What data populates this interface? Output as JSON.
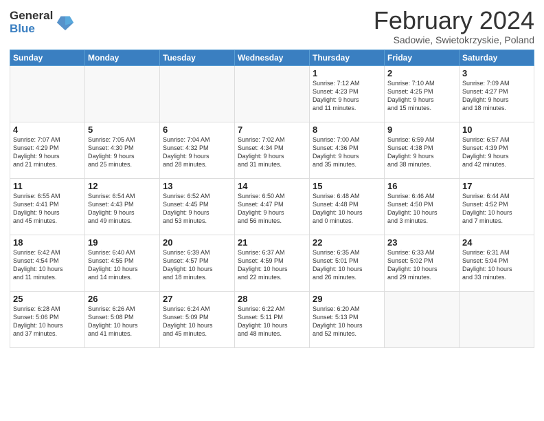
{
  "header": {
    "logo_general": "General",
    "logo_blue": "Blue",
    "title": "February 2024",
    "location": "Sadowie, Swietokrzyskie, Poland"
  },
  "weekdays": [
    "Sunday",
    "Monday",
    "Tuesday",
    "Wednesday",
    "Thursday",
    "Friday",
    "Saturday"
  ],
  "weeks": [
    [
      {
        "day": "",
        "info": ""
      },
      {
        "day": "",
        "info": ""
      },
      {
        "day": "",
        "info": ""
      },
      {
        "day": "",
        "info": ""
      },
      {
        "day": "1",
        "info": "Sunrise: 7:12 AM\nSunset: 4:23 PM\nDaylight: 9 hours\nand 11 minutes."
      },
      {
        "day": "2",
        "info": "Sunrise: 7:10 AM\nSunset: 4:25 PM\nDaylight: 9 hours\nand 15 minutes."
      },
      {
        "day": "3",
        "info": "Sunrise: 7:09 AM\nSunset: 4:27 PM\nDaylight: 9 hours\nand 18 minutes."
      }
    ],
    [
      {
        "day": "4",
        "info": "Sunrise: 7:07 AM\nSunset: 4:29 PM\nDaylight: 9 hours\nand 21 minutes."
      },
      {
        "day": "5",
        "info": "Sunrise: 7:05 AM\nSunset: 4:30 PM\nDaylight: 9 hours\nand 25 minutes."
      },
      {
        "day": "6",
        "info": "Sunrise: 7:04 AM\nSunset: 4:32 PM\nDaylight: 9 hours\nand 28 minutes."
      },
      {
        "day": "7",
        "info": "Sunrise: 7:02 AM\nSunset: 4:34 PM\nDaylight: 9 hours\nand 31 minutes."
      },
      {
        "day": "8",
        "info": "Sunrise: 7:00 AM\nSunset: 4:36 PM\nDaylight: 9 hours\nand 35 minutes."
      },
      {
        "day": "9",
        "info": "Sunrise: 6:59 AM\nSunset: 4:38 PM\nDaylight: 9 hours\nand 38 minutes."
      },
      {
        "day": "10",
        "info": "Sunrise: 6:57 AM\nSunset: 4:39 PM\nDaylight: 9 hours\nand 42 minutes."
      }
    ],
    [
      {
        "day": "11",
        "info": "Sunrise: 6:55 AM\nSunset: 4:41 PM\nDaylight: 9 hours\nand 45 minutes."
      },
      {
        "day": "12",
        "info": "Sunrise: 6:54 AM\nSunset: 4:43 PM\nDaylight: 9 hours\nand 49 minutes."
      },
      {
        "day": "13",
        "info": "Sunrise: 6:52 AM\nSunset: 4:45 PM\nDaylight: 9 hours\nand 53 minutes."
      },
      {
        "day": "14",
        "info": "Sunrise: 6:50 AM\nSunset: 4:47 PM\nDaylight: 9 hours\nand 56 minutes."
      },
      {
        "day": "15",
        "info": "Sunrise: 6:48 AM\nSunset: 4:48 PM\nDaylight: 10 hours\nand 0 minutes."
      },
      {
        "day": "16",
        "info": "Sunrise: 6:46 AM\nSunset: 4:50 PM\nDaylight: 10 hours\nand 3 minutes."
      },
      {
        "day": "17",
        "info": "Sunrise: 6:44 AM\nSunset: 4:52 PM\nDaylight: 10 hours\nand 7 minutes."
      }
    ],
    [
      {
        "day": "18",
        "info": "Sunrise: 6:42 AM\nSunset: 4:54 PM\nDaylight: 10 hours\nand 11 minutes."
      },
      {
        "day": "19",
        "info": "Sunrise: 6:40 AM\nSunset: 4:55 PM\nDaylight: 10 hours\nand 14 minutes."
      },
      {
        "day": "20",
        "info": "Sunrise: 6:39 AM\nSunset: 4:57 PM\nDaylight: 10 hours\nand 18 minutes."
      },
      {
        "day": "21",
        "info": "Sunrise: 6:37 AM\nSunset: 4:59 PM\nDaylight: 10 hours\nand 22 minutes."
      },
      {
        "day": "22",
        "info": "Sunrise: 6:35 AM\nSunset: 5:01 PM\nDaylight: 10 hours\nand 26 minutes."
      },
      {
        "day": "23",
        "info": "Sunrise: 6:33 AM\nSunset: 5:02 PM\nDaylight: 10 hours\nand 29 minutes."
      },
      {
        "day": "24",
        "info": "Sunrise: 6:31 AM\nSunset: 5:04 PM\nDaylight: 10 hours\nand 33 minutes."
      }
    ],
    [
      {
        "day": "25",
        "info": "Sunrise: 6:28 AM\nSunset: 5:06 PM\nDaylight: 10 hours\nand 37 minutes."
      },
      {
        "day": "26",
        "info": "Sunrise: 6:26 AM\nSunset: 5:08 PM\nDaylight: 10 hours\nand 41 minutes."
      },
      {
        "day": "27",
        "info": "Sunrise: 6:24 AM\nSunset: 5:09 PM\nDaylight: 10 hours\nand 45 minutes."
      },
      {
        "day": "28",
        "info": "Sunrise: 6:22 AM\nSunset: 5:11 PM\nDaylight: 10 hours\nand 48 minutes."
      },
      {
        "day": "29",
        "info": "Sunrise: 6:20 AM\nSunset: 5:13 PM\nDaylight: 10 hours\nand 52 minutes."
      },
      {
        "day": "",
        "info": ""
      },
      {
        "day": "",
        "info": ""
      }
    ]
  ]
}
